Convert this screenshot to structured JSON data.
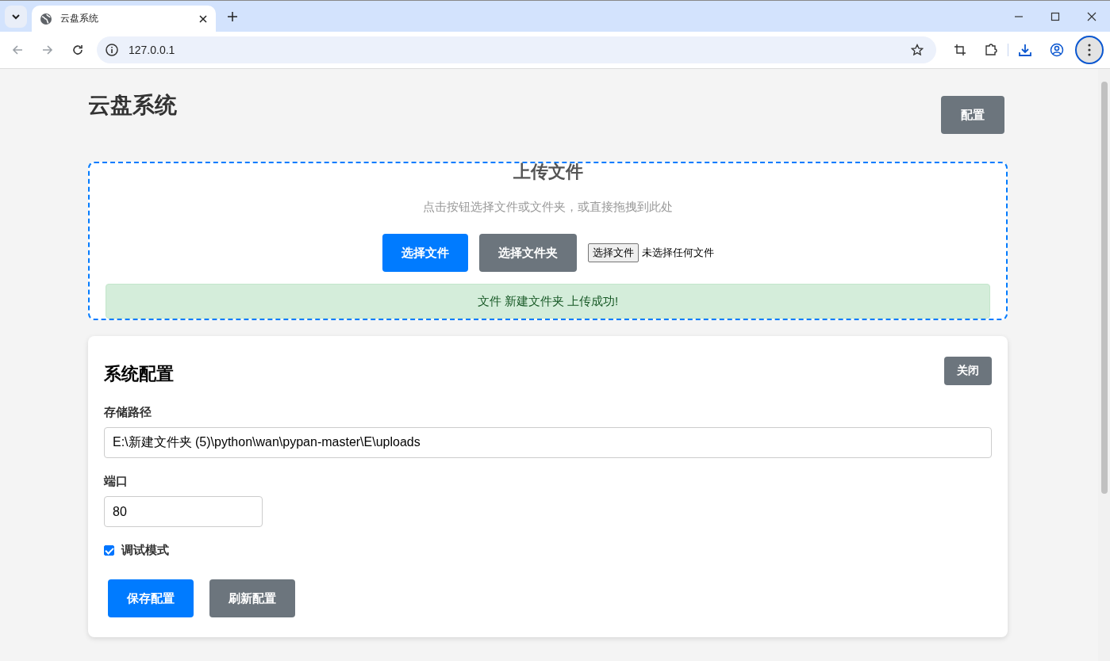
{
  "browser": {
    "tab": {
      "title": "云盘系统",
      "selected": true
    },
    "url": "127.0.0.1"
  },
  "page": {
    "title": "云盘系统",
    "config_button": "配置"
  },
  "upload": {
    "heading": "上传文件",
    "hint": "点击按钮选择文件或文件夹，或直接拖拽到此处",
    "buttons": [
      {
        "label": "选择文件",
        "kind": "primary"
      },
      {
        "label": "选择文件夹",
        "kind": "secondary"
      }
    ],
    "file_input": {
      "button": "选择文件",
      "status": "未选择任何文件"
    },
    "message": {
      "text": "文件 新建文件夹 上传成功!",
      "kind": "success"
    }
  },
  "config": {
    "title": "系统配置",
    "close": "关闭",
    "fields": [
      {
        "label": "存储路径",
        "value": "E:\\新建文件夹 (5)\\python\\wan\\pypan-master\\E\\uploads",
        "kind": "wide"
      },
      {
        "label": "端口",
        "value": "80",
        "kind": "narrow"
      }
    ],
    "debug": {
      "label": "调试模式",
      "checked": true
    },
    "actions": [
      {
        "label": "保存配置",
        "kind": "primary"
      },
      {
        "label": "刷新配置",
        "kind": "secondary"
      }
    ]
  }
}
